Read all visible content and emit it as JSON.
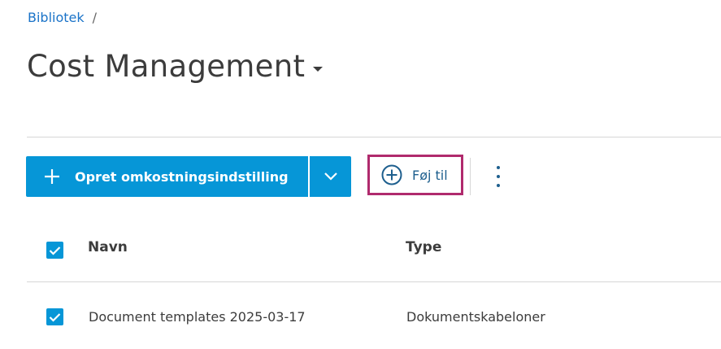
{
  "breadcrumb": {
    "root": "Bibliotek",
    "separator": "/"
  },
  "page": {
    "title": "Cost Management"
  },
  "toolbar": {
    "create_label": "Opret omkostningsindstilling",
    "add_label": "Føj til"
  },
  "table": {
    "columns": [
      "Navn",
      "Type"
    ],
    "rows": [
      {
        "name": "Document templates 2025-03-17",
        "type": "Dokumentskabeloner",
        "checked": true
      }
    ]
  },
  "colors": {
    "primary": "#0696d7",
    "highlight": "#b02a6d",
    "link": "#1a73c8"
  }
}
